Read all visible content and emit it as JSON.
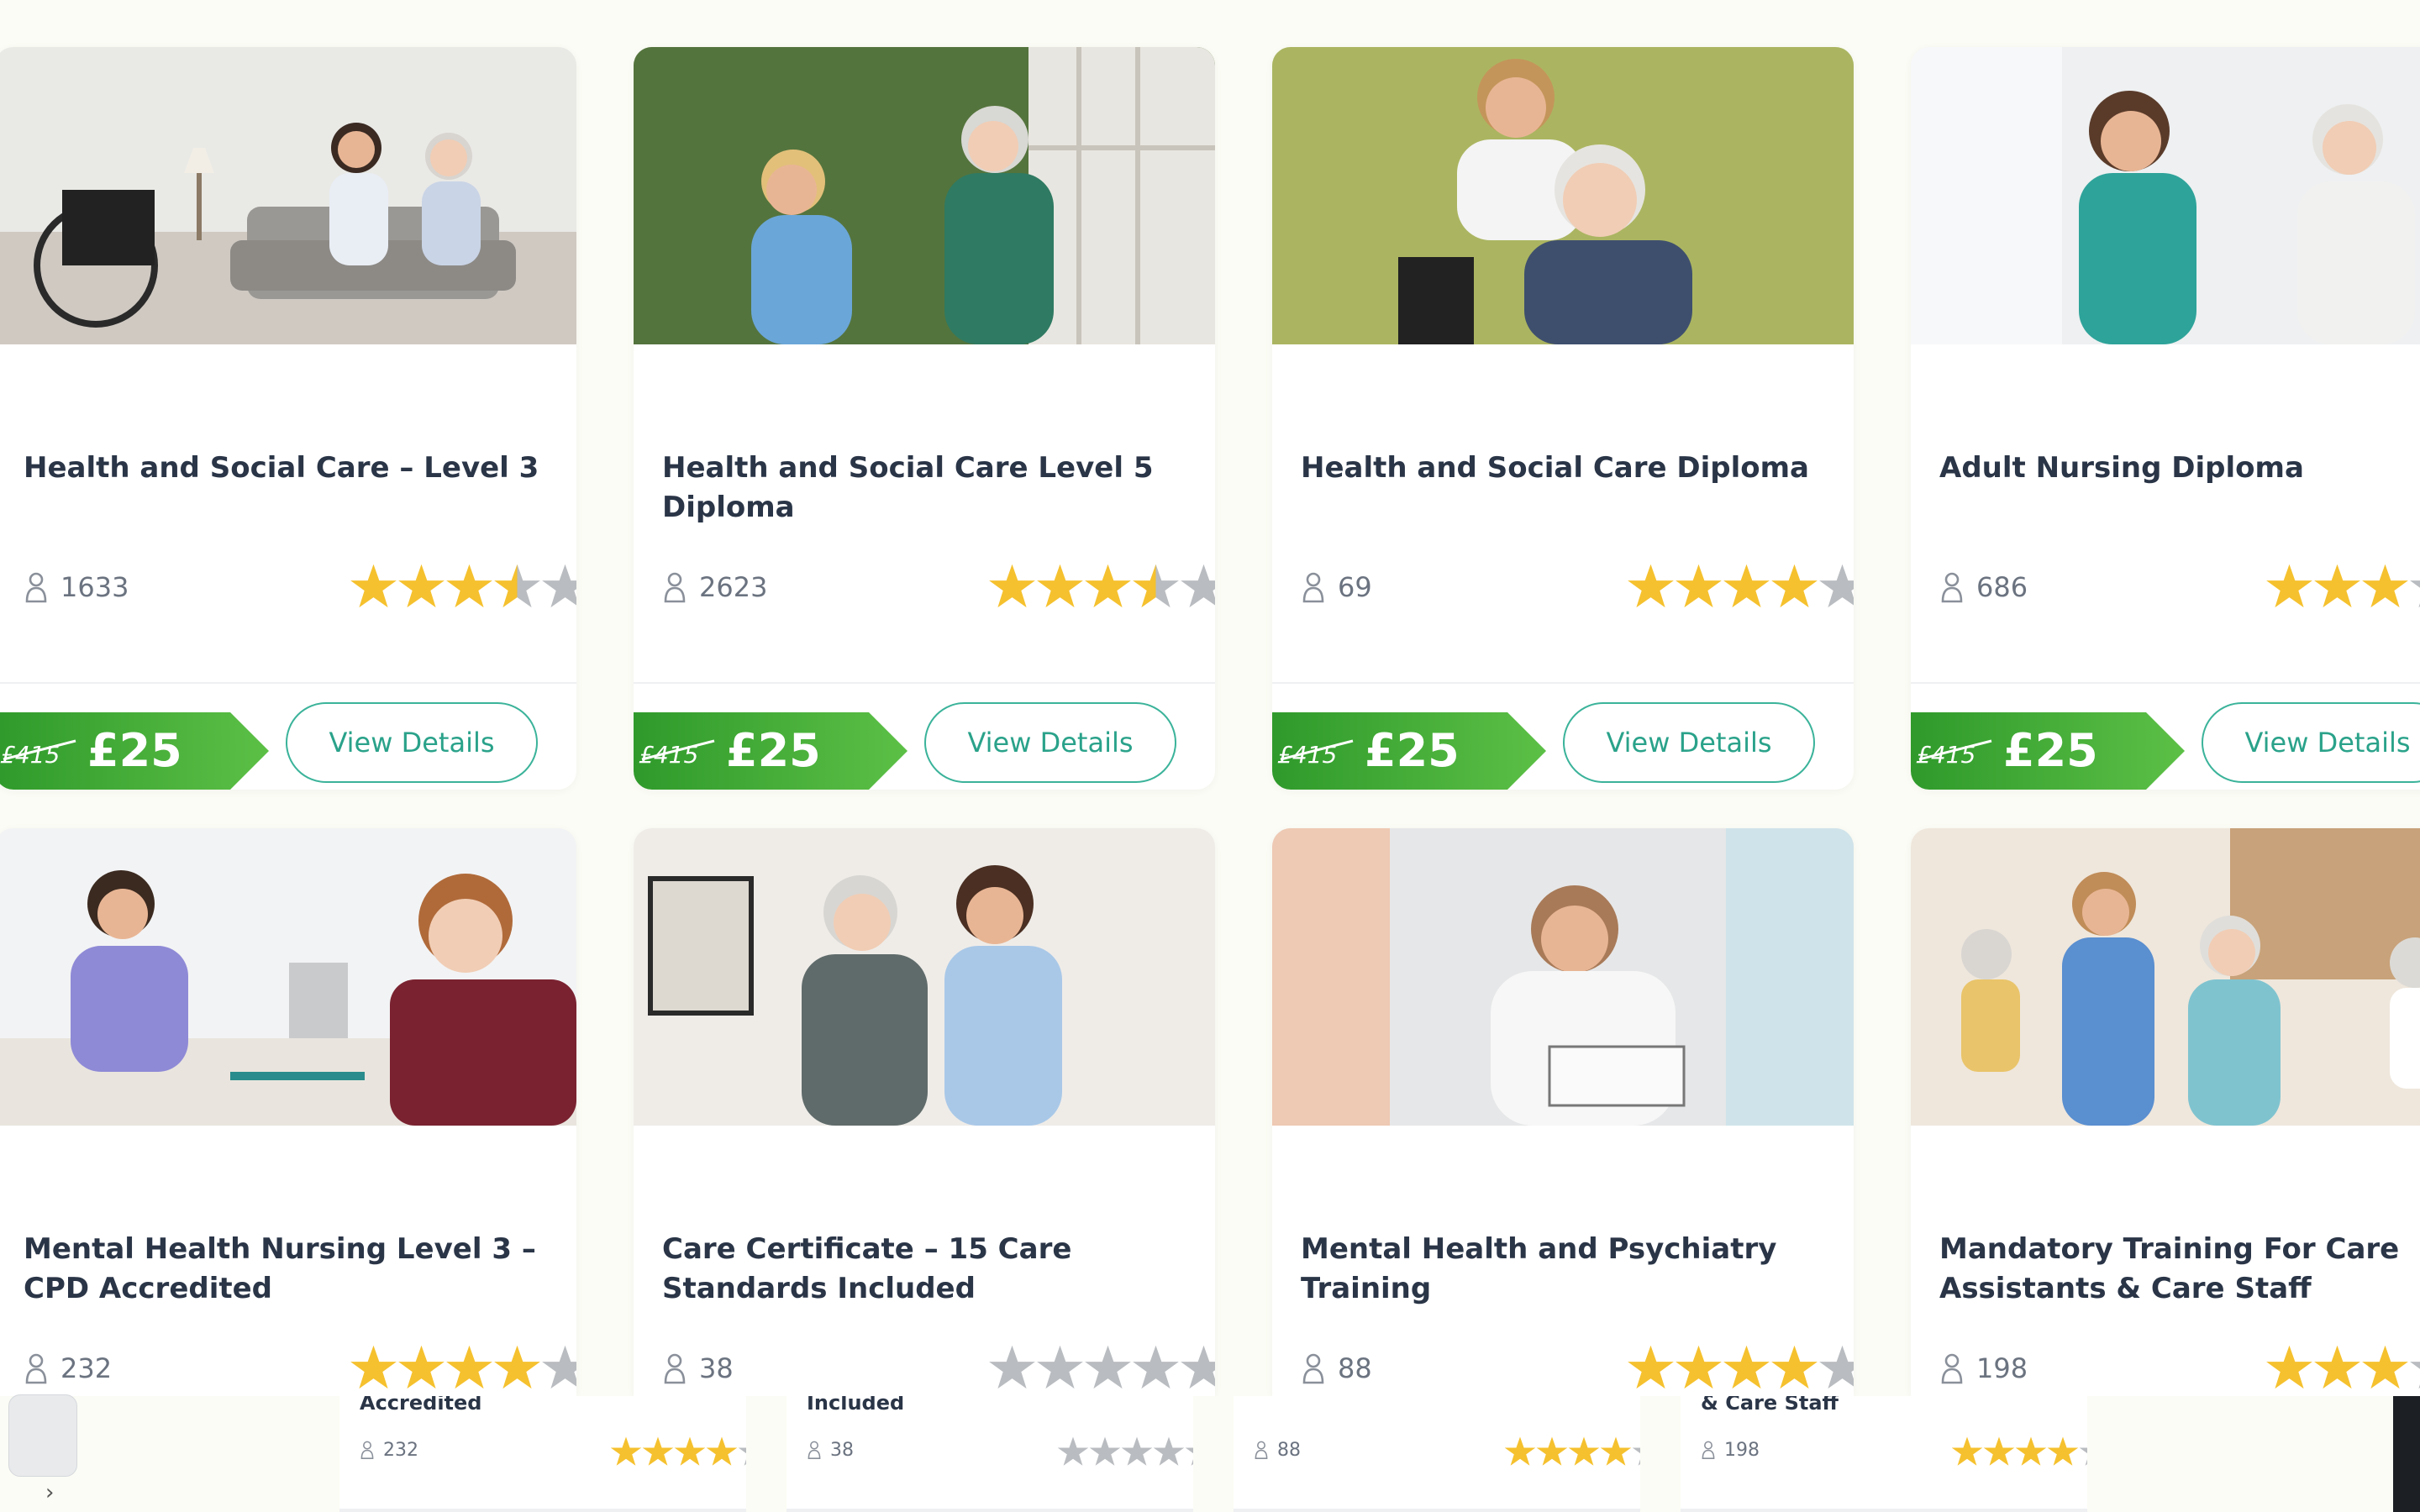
{
  "courses": [
    {
      "title": "Health and Social Care – Level 3",
      "students": "1633",
      "rating": 3.5,
      "old_price": "£415",
      "price": "£25",
      "button": "View Details",
      "img": "care-home-consult"
    },
    {
      "title": "Health and Social Care Level 5 Diploma",
      "students": "2623",
      "rating": 3.5,
      "old_price": "£415",
      "price": "£25",
      "button": "View Details",
      "img": "garden-wheelchair"
    },
    {
      "title": "Health and Social Care Diploma",
      "students": "69",
      "rating": 4,
      "old_price": "£415",
      "price": "£25",
      "button": "View Details",
      "img": "smiling-elder"
    },
    {
      "title": "Adult Nursing Diploma",
      "students": "686",
      "rating": 3,
      "old_price": "£415",
      "price": "£25",
      "button": "View Details",
      "img": "nurse-scrubs"
    },
    {
      "title": "Mental Health Nursing Level 3 – CPD Accredited",
      "students": "232",
      "rating": 4,
      "img": "nurse-patient-desk"
    },
    {
      "title": "Care Certificate – 15 Care Standards Included",
      "students": "38",
      "rating": 0,
      "img": "nurse-walking-elder"
    },
    {
      "title": "Mental Health and Psychiatry Training",
      "students": "88",
      "rating": 4,
      "img": "distressed-man"
    },
    {
      "title": "Mandatory Training For Care Assistants & Care Staff",
      "students": "198",
      "rating": 3,
      "img": "care-lounge"
    }
  ],
  "strip": [
    {
      "clip": "Accredited",
      "students": "232",
      "rating": 4
    },
    {
      "clip": "Included",
      "students": "38",
      "rating": 0
    },
    {
      "clip": "",
      "students": "88",
      "rating": 4
    },
    {
      "clip": "& Care Staff",
      "students": "198",
      "rating": 4
    }
  ],
  "colors": {
    "accent": "#3bb39a",
    "price_tag": "#3fae3a",
    "star_on": "#f5c12e",
    "star_off": "#b9bcc0"
  }
}
